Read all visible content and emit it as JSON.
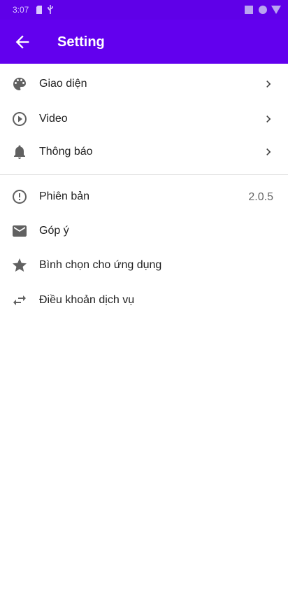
{
  "status_bar": {
    "time": "3:07"
  },
  "app_bar": {
    "title": "Setting"
  },
  "section_1": [
    {
      "label": "Giao diện"
    },
    {
      "label": "Video"
    },
    {
      "label": "Thông báo"
    }
  ],
  "section_2": [
    {
      "label": "Phiên bản",
      "value": "2.0.5"
    },
    {
      "label": "Góp ý"
    },
    {
      "label": "Bình chọn cho ứng dụng"
    },
    {
      "label": "Điều khoản dịch vụ"
    }
  ],
  "colors": {
    "status_bar": "#5f00e8",
    "app_bar": "#6200ee",
    "icon": "#616161"
  }
}
